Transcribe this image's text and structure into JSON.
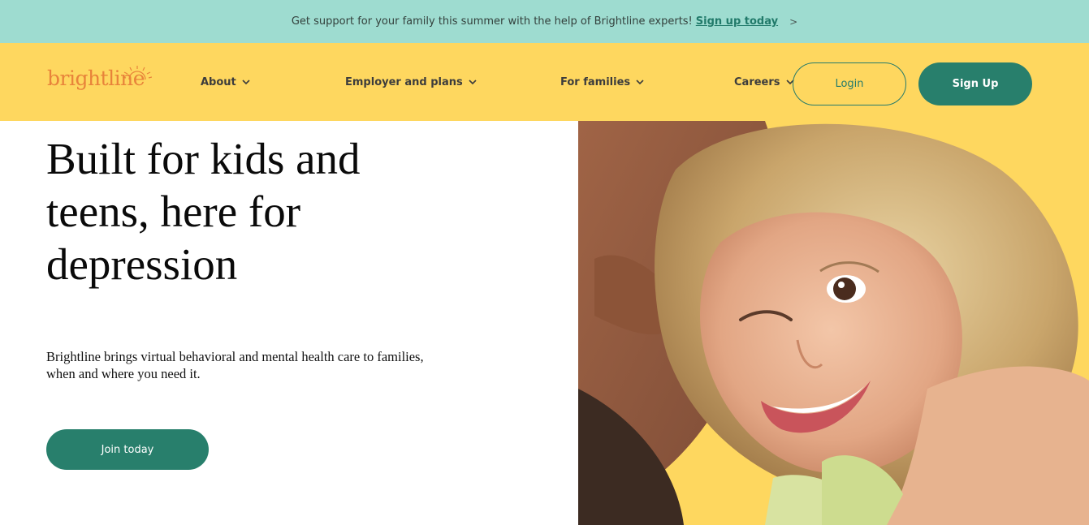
{
  "promo": {
    "text": "Get support for your family this summer with the help of Brightline experts!",
    "link": "Sign up today",
    "arrow": ">"
  },
  "header": {
    "logo": "brightline",
    "nav": [
      {
        "label": "About"
      },
      {
        "label": "Employer and plans"
      },
      {
        "label": "For families"
      },
      {
        "label": "Careers"
      }
    ],
    "login": "Login",
    "signup": "Sign Up"
  },
  "hero": {
    "title": "Built for kids and teens, here for depression",
    "subtitle": "Brightline brings virtual behavioral and mental health care to families, when and where you need it.",
    "cta": "Join today"
  },
  "colors": {
    "promo_bg": "#9edcd0",
    "header_bg": "#fed75f",
    "accent": "#287f6c",
    "logo": "#e8833a"
  }
}
